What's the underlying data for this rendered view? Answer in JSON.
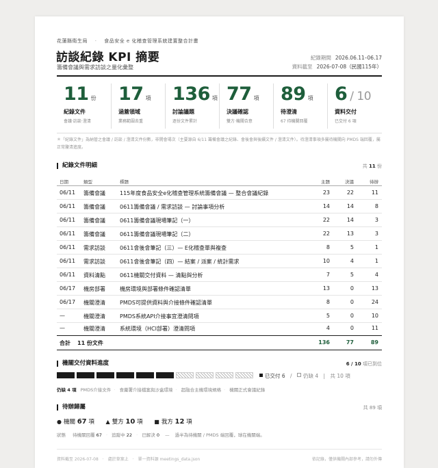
{
  "header": {
    "org": "花蓮縣衛生局",
    "project": "食品安全 e 化稽查管理系統建置整合計畫",
    "title": "訪談紀錄 KPI 摘要",
    "subtitle": "籌備會議與需求訪談之量化彙整",
    "period_label": "紀錄期間",
    "period_value": "2026.06.11–06.17",
    "cutoff_label": "資料截至",
    "cutoff_value": "2026-07-08（民國115年）"
  },
  "kpis": [
    {
      "value": "11",
      "unit": "份",
      "label": "紀錄文件",
      "sub": "會議·訪談·澄清"
    },
    {
      "value": "17",
      "unit": "項",
      "label": "涵蓋領域",
      "sub": "業務範圍去重"
    },
    {
      "value": "136",
      "unit": "項",
      "label": "討論議題",
      "sub": "逐份文件累計"
    },
    {
      "value": "77",
      "unit": "項",
      "label": "決議確認",
      "sub": "雙方·機關合意"
    },
    {
      "value": "89",
      "unit": "項",
      "label": "待澄清",
      "sub": "67 待機關回覆"
    },
    {
      "value": "6",
      "unit": "/ 10",
      "label": "資料交付",
      "sub": "已交付 6 項"
    }
  ],
  "note": "＊「紀錄文件」為納管之會議 / 訪談 / 澄清文件份數，非開會場次（主要源自 6/11 籌備會議之紀錄、會後會與後續文件 / 澄清文件）。待澄清事項多屬待機關向 PMDS 端回覆，屬正常釐清進度。",
  "docs": {
    "section_title": "紀錄文件明細",
    "count_prefix": "共",
    "count_value": "11",
    "count_suffix": "份",
    "columns": [
      "日期",
      "類型",
      "標題",
      "主題",
      "決議",
      "待辦"
    ],
    "rows": [
      {
        "date": "06/11",
        "type": "籌備會議",
        "title": "115年度食品安全e化稽查管理系統籌備會議 — 整合會議紀錄",
        "a": "23",
        "b": "22",
        "c": "11"
      },
      {
        "date": "06/11",
        "type": "籌備會議",
        "title": "0611籌備會議 / 需求訪談 — 討論事項分析",
        "a": "14",
        "b": "14",
        "c": "8"
      },
      {
        "date": "06/11",
        "type": "籌備會議",
        "title": "0611籌備會議現場筆記（一）",
        "a": "22",
        "b": "14",
        "c": "3"
      },
      {
        "date": "06/11",
        "type": "籌備會議",
        "title": "0611籌備會議現場筆記（二）",
        "a": "22",
        "b": "13",
        "c": "3"
      },
      {
        "date": "06/11",
        "type": "需求訪談",
        "title": "0611會後會筆記（三）— E化稽查單與複查",
        "a": "8",
        "b": "5",
        "c": "1"
      },
      {
        "date": "06/11",
        "type": "需求訪談",
        "title": "0611會後會筆記（四）— 結案 / 派案 / 統計需求",
        "a": "10",
        "b": "4",
        "c": "1"
      },
      {
        "date": "06/11",
        "type": "資料清點",
        "title": "0611機關交付資料 — 清點與分析",
        "a": "7",
        "b": "5",
        "c": "4"
      },
      {
        "date": "06/17",
        "type": "機房部署",
        "title": "機房環境與部署條件確認清單",
        "a": "13",
        "b": "0",
        "c": "13"
      },
      {
        "date": "06/17",
        "type": "機關澄清",
        "title": "PMDS可提供資料與介接條件確認清單",
        "a": "8",
        "b": "0",
        "c": "24"
      },
      {
        "date": "—",
        "type": "機關澄清",
        "title": "PMDS系統API介接事宜澄清問項",
        "a": "5",
        "b": "0",
        "c": "10"
      },
      {
        "date": "—",
        "type": "機關澄清",
        "title": "系統環境（HCI部署）澄清問項",
        "a": "4",
        "b": "0",
        "c": "11"
      }
    ],
    "total_label": "合計",
    "total_docs": "11 份文件",
    "total_a": "136",
    "total_b": "77",
    "total_c": "89"
  },
  "delivery": {
    "section_title": "機關交付資料進度",
    "ratio": "6 / 10",
    "ratio_suffix": "項已到位",
    "delivered": 6,
    "total": 10,
    "legend_done": "已交付 6",
    "legend_pending": "仍缺 4",
    "legend_total": "共 10 項",
    "pending_label": "仍缺 4 項",
    "pending_items": [
      "PMDS介接文件",
      "食藥署介接檔案與沙盒環境",
      "超融合主機環境規格",
      "機關正式會議紀錄"
    ]
  },
  "todo": {
    "section_title": "待辦歸屬",
    "count_text": "共 89 項",
    "items": [
      {
        "marker": "●",
        "label": "機關",
        "value": "67",
        "unit": "項"
      },
      {
        "marker": "▲",
        "label": "雙方",
        "value": "10",
        "unit": "項"
      },
      {
        "marker": "■",
        "label": "我方",
        "value": "12",
        "unit": "項"
      }
    ],
    "status_label": "狀態",
    "status_wait_label": "待機關回覆",
    "status_wait": "67",
    "status_track_label": "追蹤中",
    "status_track": "22",
    "status_done_label": "已解決",
    "status_done": "0",
    "status_note": "過半為待機關 / PMDS 端回覆，球在機關端。"
  },
  "footer": {
    "left_1": "資料截至 2026-07-08",
    "left_2": "處於草案上",
    "left_3": "單一資料源 meetings_data.json",
    "right": "依記錄，僅供機關內部參考，請勿外傳"
  },
  "colors": {
    "accent": "#1e5e3b",
    "ink": "#1a1a1a"
  }
}
